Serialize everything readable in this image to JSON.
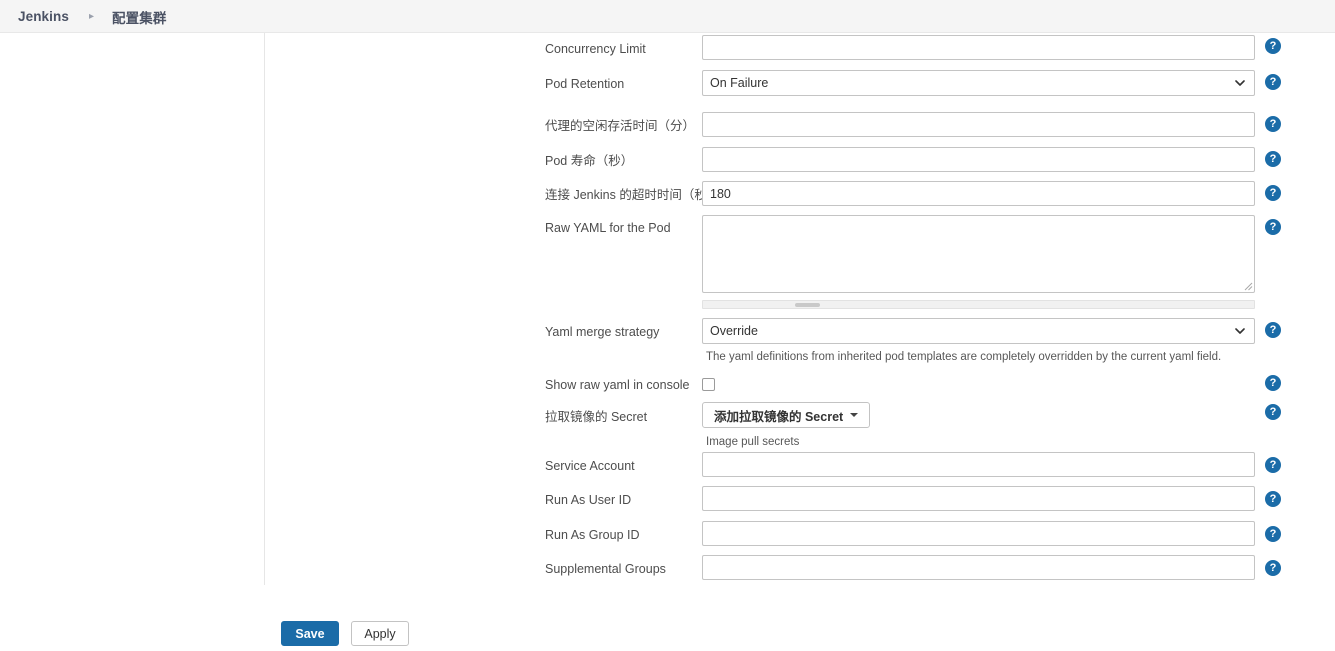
{
  "header": {
    "breadcrumb": [
      {
        "label": "Jenkins"
      },
      {
        "label": "配置集群"
      }
    ],
    "separator": "▸"
  },
  "form": {
    "rows": [
      {
        "label": "Concurrency Limit",
        "type": "text",
        "value": "",
        "placeholder": "",
        "help": "?"
      },
      {
        "label": "Pod Retention",
        "type": "select",
        "value": "On Failure",
        "help": "?"
      },
      {
        "label": "代理的空闲存活时间（分）",
        "type": "text",
        "value": "",
        "placeholder": "",
        "help": "?"
      },
      {
        "label": "Pod 寿命（秒）",
        "type": "text",
        "value": "",
        "placeholder": "",
        "help": "?"
      },
      {
        "label": "连接 Jenkins 的超时时间（秒）",
        "type": "text",
        "value": "180",
        "placeholder": "",
        "help": "?"
      },
      {
        "label": "Raw YAML for the Pod",
        "type": "textarea",
        "value": "",
        "help": "?"
      },
      {
        "label": "Yaml merge strategy",
        "type": "select",
        "value": "Override",
        "description": "The yaml definitions from inherited pod templates are completely overridden by the current yaml field.",
        "help": "?"
      },
      {
        "label": "Show raw yaml in console",
        "type": "checkbox",
        "checked": false,
        "help": "?"
      },
      {
        "label": "拉取镜像的 Secret",
        "type": "dropdown-button",
        "button_label": "添加拉取镜像的 Secret",
        "description": "Image pull secrets",
        "help": "?"
      },
      {
        "label": "Service Account",
        "type": "text",
        "value": "",
        "placeholder": "",
        "help": "?"
      },
      {
        "label": "Run As User ID",
        "type": "text",
        "value": "",
        "placeholder": "",
        "help": "?"
      },
      {
        "label": "Run As Group ID",
        "type": "text",
        "value": "",
        "placeholder": "",
        "help": "?"
      },
      {
        "label": "Supplemental Groups",
        "type": "text",
        "value": "",
        "placeholder": "",
        "help": "?"
      }
    ]
  },
  "footer": {
    "save_label": "Save",
    "apply_label": "Apply"
  },
  "colors": {
    "accent": "#1b6ca8",
    "header_bg": "#f5f5f5",
    "border": "#c4c4c4"
  }
}
